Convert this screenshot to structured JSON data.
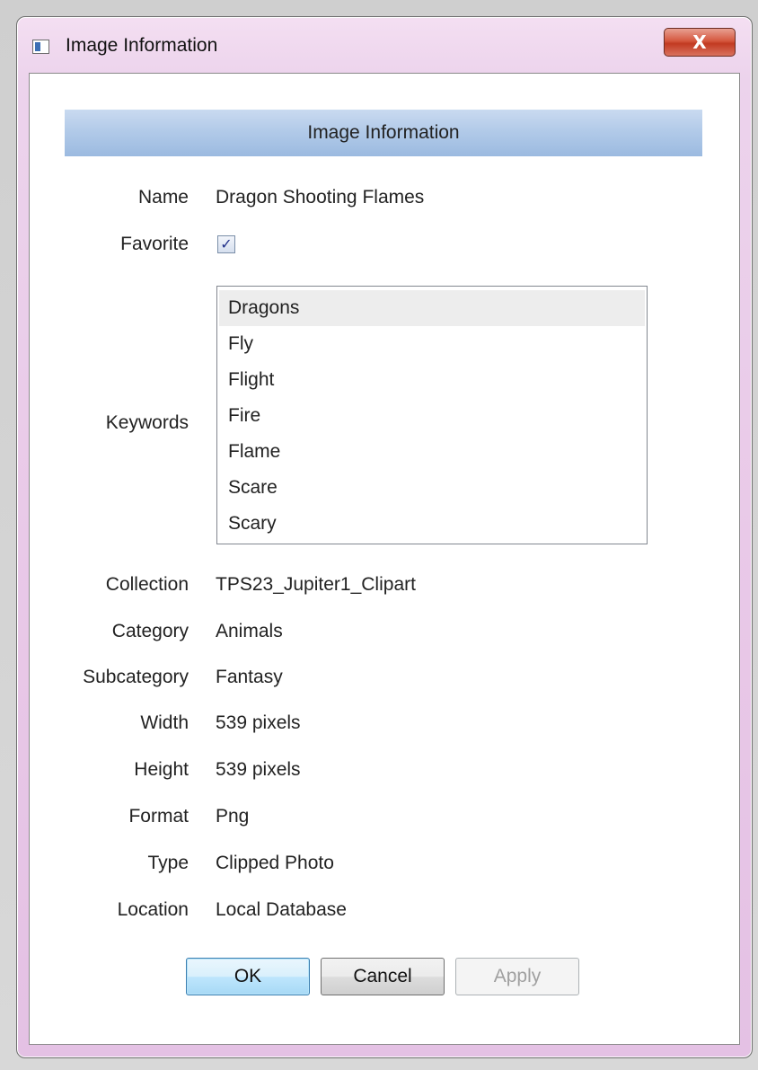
{
  "window": {
    "title": "Image Information",
    "close_label": "X"
  },
  "header": {
    "title": "Image Information"
  },
  "fields": {
    "name_label": "Name",
    "name_value": "Dragon Shooting Flames",
    "favorite_label": "Favorite",
    "favorite_checked": true,
    "keywords_label": "Keywords",
    "keywords": [
      "Dragons",
      "Fly",
      "Flight",
      "Fire",
      "Flame",
      "Scare",
      "Scary"
    ],
    "keywords_selected": "Dragons",
    "collection_label": "Collection",
    "collection_value": "TPS23_Jupiter1_Clipart",
    "category_label": "Category",
    "category_value": "Animals",
    "subcategory_label": "Subcategory",
    "subcategory_value": "Fantasy",
    "width_label": "Width",
    "width_value": "539 pixels",
    "height_label": "Height",
    "height_value": "539 pixels",
    "format_label": "Format",
    "format_value": "Png",
    "type_label": "Type",
    "type_value": "Clipped Photo",
    "location_label": "Location",
    "location_value": "Local Database"
  },
  "buttons": {
    "ok_label": "OK",
    "cancel_label": "Cancel",
    "apply_label": "Apply",
    "apply_enabled": false
  },
  "colors": {
    "header_band": "#b0c9e8",
    "selected_item": "#ededed",
    "close_button": "#c23a21"
  }
}
